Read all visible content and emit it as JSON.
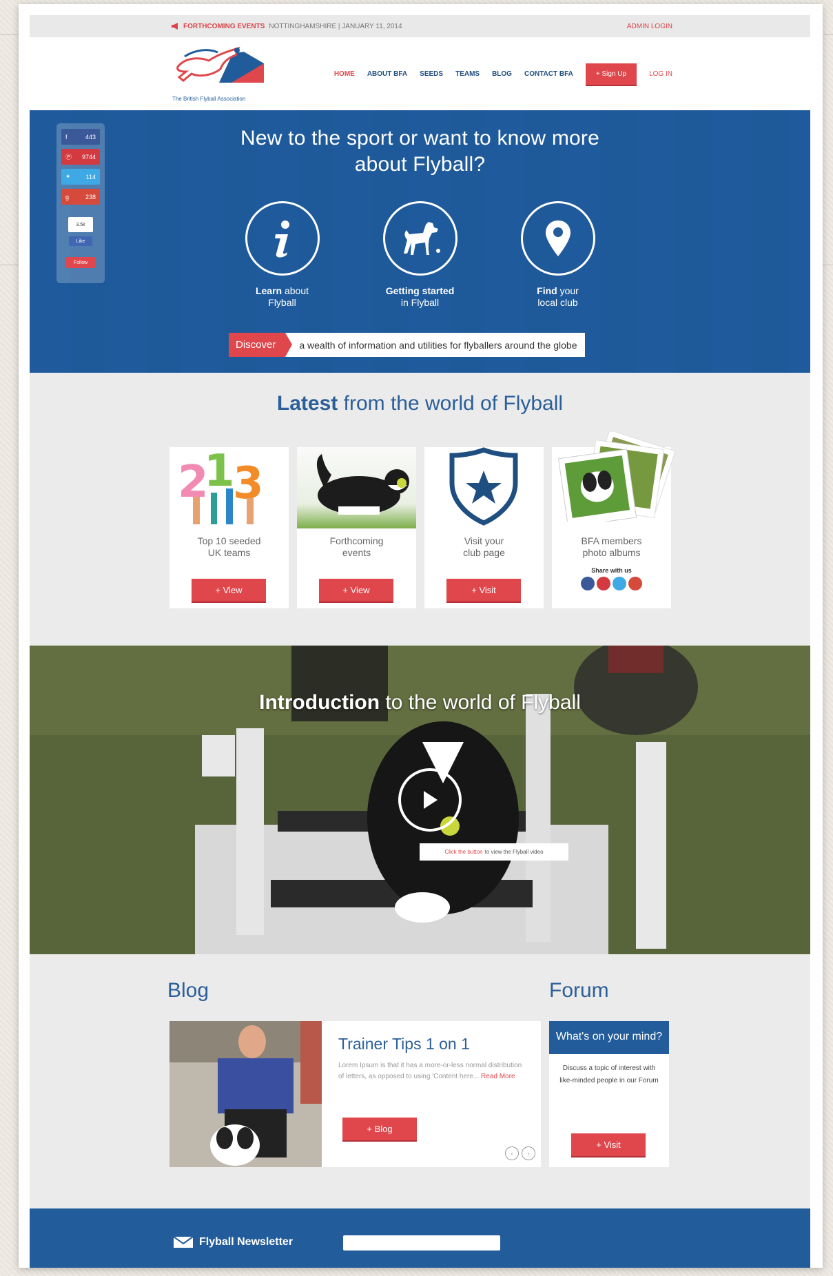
{
  "topbar": {
    "events_label": "FORTHCOMING EVENTS",
    "event_info": "NOTTINGHAMSHIRE | JANUARY 11, 2014",
    "admin_login": "ADMIN LOGIN"
  },
  "header": {
    "logo_tagline": "The British Flyball Association",
    "nav": {
      "home": "HOME",
      "about": "ABOUT BFA",
      "seeds": "SEEDS",
      "teams": "TEAMS",
      "blog": "BLOG",
      "contact": "CONTACT BFA",
      "signup": "+ Sign Up",
      "login": "LOG IN"
    }
  },
  "social": {
    "facebook_count": "443",
    "pinterest_count": "9744",
    "twitter_count": "114",
    "google_count": "238",
    "small1": "3.5k",
    "like": "Like",
    "follow": "Follow"
  },
  "hero": {
    "title_line1": "New to the sport or want to know more",
    "title_line2": "about Flyball?",
    "items": [
      {
        "bold": "Learn",
        "rest": " about",
        "line2": "Flyball"
      },
      {
        "bold": "Getting started",
        "rest": "",
        "line2": "in Flyball"
      },
      {
        "bold": "Find",
        "rest": " your",
        "line2": "local club"
      }
    ],
    "discover_tag": "Discover",
    "discover_text": "a wealth of information and utilities for flyballers around the globe"
  },
  "latest": {
    "title_bold": "Latest",
    "title_rest": " from the world of Flyball",
    "cards": [
      {
        "line1": "Top 10 seeded",
        "line2": "UK teams",
        "button": "+ View"
      },
      {
        "line1": "Forthcoming",
        "line2": "events",
        "button": "+ View"
      },
      {
        "line1": "Visit your",
        "line2": "club page",
        "button": "+ Visit"
      },
      {
        "line1": "BFA members",
        "line2": "photo albums",
        "share": "Share with us"
      }
    ]
  },
  "video": {
    "title_bold": "Introduction",
    "title_rest": " to the world of Flyball",
    "note_highlight": "Click the button",
    "note_rest": "to view the Flyball video"
  },
  "blog": {
    "heading": "Blog",
    "post_title": "Trainer Tips 1 on 1",
    "excerpt": "Lorem Ipsum is that it has a more-or-less normal distribution of letters, as opposed to using 'Content here...",
    "read_more": "Read More",
    "button": "+ Blog"
  },
  "forum": {
    "heading": "Forum",
    "card_title": "What's on your mind?",
    "text": "Discuss a topic of interest with like-minded people in our Forum",
    "button": "+ Visit"
  },
  "footer": {
    "newsletter": "Flyball Newsletter"
  },
  "colors": {
    "brand_blue": "#235c9a",
    "accent_red": "#e0474c"
  }
}
